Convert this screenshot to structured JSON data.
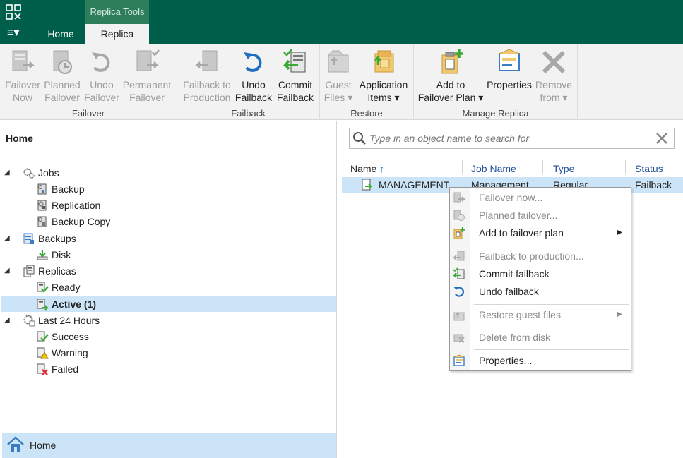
{
  "titlebar": {
    "context_group": "Replica Tools",
    "menu_label": "≡▾"
  },
  "tabs": [
    {
      "label": "Home"
    },
    {
      "label": "Replica"
    }
  ],
  "ribbon": {
    "groups": [
      {
        "label": "Failover",
        "buttons": [
          {
            "line1": "Failover",
            "line2": "Now",
            "icon": "failover-now-icon",
            "enabled": false
          },
          {
            "line1": "Planned",
            "line2": "Failover",
            "icon": "planned-failover-icon",
            "enabled": false
          },
          {
            "line1": "Undo",
            "line2": "Failover",
            "icon": "undo-icon",
            "enabled": false
          },
          {
            "line1": "Permanent",
            "line2": "Failover",
            "icon": "permanent-failover-icon",
            "enabled": false
          }
        ]
      },
      {
        "label": "Failback",
        "buttons": [
          {
            "line1": "Failback to",
            "line2": "Production",
            "icon": "failback-icon",
            "enabled": false
          },
          {
            "line1": "Undo",
            "line2": "Failback",
            "icon": "undo-icon",
            "enabled": true
          },
          {
            "line1": "Commit",
            "line2": "Failback",
            "icon": "commit-failback-icon",
            "enabled": true
          }
        ]
      },
      {
        "label": "Restore",
        "buttons": [
          {
            "line1": "Guest",
            "line2": "Files ▾",
            "icon": "guest-files-icon",
            "enabled": false
          },
          {
            "line1": "Application",
            "line2": "Items ▾",
            "icon": "application-items-icon",
            "enabled": true
          }
        ]
      },
      {
        "label": "Manage Replica",
        "buttons": [
          {
            "line1": "Add to",
            "line2": "Failover Plan ▾",
            "icon": "add-to-plan-icon",
            "enabled": true
          },
          {
            "line1": "Properties",
            "line2": "",
            "icon": "properties-icon",
            "enabled": true
          },
          {
            "line1": "Remove",
            "line2": "from ▾",
            "icon": "remove-icon",
            "enabled": false
          }
        ]
      }
    ]
  },
  "leftpane": {
    "title": "Home",
    "tree": {
      "jobs": "Jobs",
      "backup": "Backup",
      "replication": "Replication",
      "backup_copy": "Backup Copy",
      "backups": "Backups",
      "disk": "Disk",
      "replicas": "Replicas",
      "ready": "Ready",
      "active": "Active (1)",
      "last24": "Last 24 Hours",
      "success": "Success",
      "warning": "Warning",
      "failed": "Failed"
    },
    "bottom_nav": "Home"
  },
  "search": {
    "placeholder": "Type in an object name to search for",
    "value": ""
  },
  "grid": {
    "columns": {
      "name": "Name",
      "job": "Job Name",
      "type": "Type",
      "status": "Status"
    },
    "sort_indicator": "↑",
    "row": {
      "name": "MANAGEMENT",
      "job": "Management",
      "type": "Regular",
      "status": "Failback"
    }
  },
  "context_menu": {
    "items": {
      "failover_now": "Failover now...",
      "planned_failover": "Planned failover...",
      "add_to_plan": "Add to failover plan",
      "failback_production": "Failback to production...",
      "commit_failback": "Commit failback",
      "undo_failback": "Undo failback",
      "restore_guest": "Restore guest files",
      "delete_disk": "Delete from disk",
      "properties": "Properties..."
    },
    "submenu_arrow": "▶"
  },
  "colors": {
    "brand": "#005f4b",
    "selection": "#cce4f7",
    "accent_green": "#3aa935",
    "accent_blue": "#1f6fbf"
  }
}
